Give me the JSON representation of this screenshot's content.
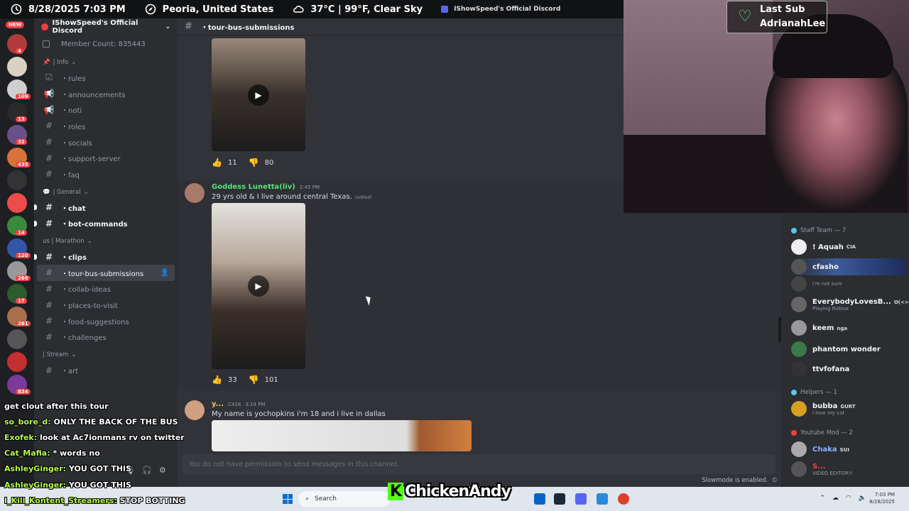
{
  "topbar": {
    "datetime": "8/28/2025 7:03 PM",
    "location": "Peoria, United States",
    "weather": "37°C | 99°F, Clear Sky",
    "discord_name": "IShowSpeed's Official Discord"
  },
  "rail": {
    "new_label": "NEW",
    "badges": [
      "4",
      "109",
      "13",
      "32",
      "435",
      "14",
      "120",
      "266",
      "17",
      "261",
      "834"
    ]
  },
  "sidebar": {
    "server_name": "IShowSpeed's Official Discord",
    "member_count": "Member Count: 835443",
    "categories": {
      "info": "| Info",
      "general": "| General",
      "marathon": "us | Marathon",
      "stream": "| Stream"
    },
    "channels_info": [
      "・rules",
      "・announcements",
      "・noti",
      "・roles",
      "・socials",
      "・support-server",
      "・faq"
    ],
    "channels_general": [
      "・chat",
      "・bot-commands"
    ],
    "channels_marathon": [
      "・clips",
      "・tour-bus-submissions",
      "・collab-ideas",
      "・places-to-visit",
      "・food-suggestions",
      "・challenges"
    ],
    "channels_stream": [
      "・art"
    ]
  },
  "channel": {
    "name": "・tour-bus-submissions",
    "composer_placeholder": "You do not have permission to send messages in this channel.",
    "slowmode": "Slowmode is enabled."
  },
  "messages": [
    {
      "reactions": [
        {
          "emoji": "👍",
          "count": "11"
        },
        {
          "emoji": "👎",
          "count": "80"
        }
      ]
    },
    {
      "author": "Goddess Lunetta(liv)",
      "time": "2:45 PM",
      "text": "29 yrs old & I live around central Texas.",
      "edited": "(edited)",
      "reactions": [
        {
          "emoji": "👍",
          "count": "33"
        },
        {
          "emoji": "👎",
          "count": "101"
        }
      ]
    },
    {
      "author": "y...",
      "tag": "C418",
      "time": "3:14 PM",
      "text": "My name is yochopkins i'm 18 and i live in dallas"
    }
  ],
  "chat_overlay": [
    {
      "user": "",
      "msg": "get clout after this tour"
    },
    {
      "user": "so_bore_d:",
      "msg": "ONLY THE BACK OF THE BUS"
    },
    {
      "user": "Exofek:",
      "msg": "look at Ac7ionmans rv on twitter"
    },
    {
      "user": "Cat_Mafia:",
      "msg": "* words no"
    },
    {
      "user": "AshleyGinger:",
      "msg": "YOU GOT THIS"
    },
    {
      "user": "AshleyGinger:",
      "msg": "YOU GOT THIS"
    },
    {
      "user": "I_Kill_Kontent_Streamers:",
      "msg": "STOP BOTTING"
    }
  ],
  "last_sub": {
    "label": "Last Sub",
    "name": "AdrianahLee"
  },
  "members": {
    "staff_header": "Staff Team — 7",
    "staff": [
      {
        "name": "! Aquah",
        "tag": "CIA"
      },
      {
        "name": "cfasho",
        "tag": ""
      },
      {
        "name": "",
        "tag": "",
        "sub": "i'm not sure"
      },
      {
        "name": "EverybodyLovesB...",
        "tag": "O(<>",
        "sub": "Playing Roblox"
      },
      {
        "name": "keem",
        "tag": "nga"
      },
      {
        "name": "phantom wonder",
        "tag": ""
      },
      {
        "name": "ttvfofana",
        "tag": ""
      }
    ],
    "helpers_header": "Helpers — 1",
    "helpers": [
      {
        "name": "bubba",
        "tag": "GURT",
        "sub": "i love my cat"
      }
    ],
    "ytmod_header": "Youtube Mod — 2",
    "ytmods": [
      {
        "name": "Chaka",
        "tag": "SUI"
      },
      {
        "name": "S...",
        "tag": "",
        "sub": "VIDEO EDITOR!!"
      }
    ]
  },
  "taskbar": {
    "search_placeholder": "Search",
    "time": "7:03 PM",
    "date": "8/28/2025"
  },
  "watermark": {
    "k": "K",
    "name": "ChickenAndy"
  }
}
